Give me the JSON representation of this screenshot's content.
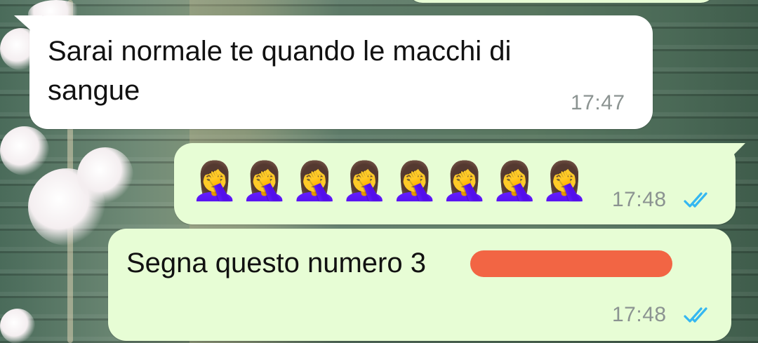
{
  "messages": [
    {
      "direction": "incoming",
      "text": "Sarai normale te quando le macchi di sangue",
      "line1": "Sarai normale te quando le macchi di",
      "line2": "sangue",
      "time": "17:47"
    },
    {
      "direction": "outgoing",
      "emoji": "🤦‍♀️",
      "emoji_count": 8,
      "time": "17:48",
      "status": "read"
    },
    {
      "direction": "outgoing",
      "text": "Segna questo numero 3",
      "redacted": true,
      "time": "17:48",
      "status": "read"
    }
  ],
  "colors": {
    "incoming_bubble": "#ffffff",
    "outgoing_bubble": "#e7fdd5",
    "read_ticks": "#34b7f1",
    "timestamp": "#8b9391",
    "redaction": "#f26544"
  },
  "icons": {
    "read_status": "double-check-icon",
    "facepalm": "woman-facepalming-emoji"
  }
}
